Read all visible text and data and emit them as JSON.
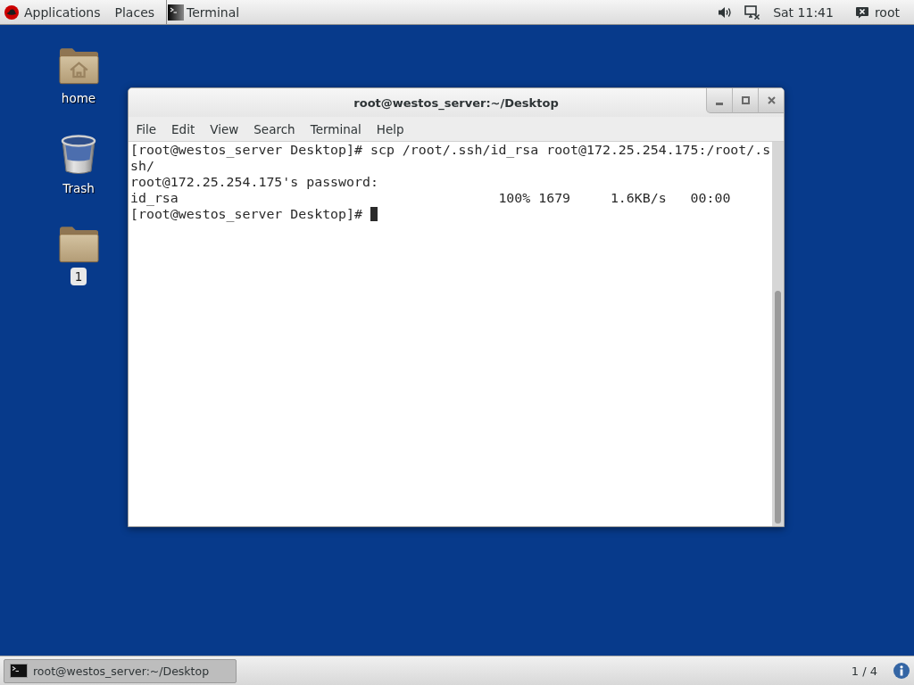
{
  "top_bar": {
    "menus": [
      {
        "kind": "applications",
        "label": "Applications"
      },
      {
        "kind": "places",
        "label": "Places"
      }
    ],
    "active_app": {
      "label": "Terminal"
    },
    "clock": "Sat 11:41",
    "user": "root"
  },
  "desktop_icons": [
    {
      "kind": "home",
      "label": "home",
      "selected": false
    },
    {
      "kind": "trash",
      "label": "Trash",
      "selected": false
    },
    {
      "kind": "folder",
      "label": "1",
      "selected": true
    }
  ],
  "terminal_window": {
    "title": "root@westos_server:~/Desktop",
    "menu": [
      "File",
      "Edit",
      "View",
      "Search",
      "Terminal",
      "Help"
    ],
    "lines": [
      "[root@westos_server Desktop]# scp /root/.ssh/id_rsa root@172.25.254.175:/root/.s",
      "sh/",
      "root@172.25.254.175's password:",
      "id_rsa                                        100% 1679     1.6KB/s   00:00",
      "[root@westos_server Desktop]#"
    ]
  },
  "taskbar": {
    "windows": [
      {
        "label": "root@westos_server:~/Desktop",
        "selected": true
      }
    ],
    "workspace": "1 / 4"
  }
}
